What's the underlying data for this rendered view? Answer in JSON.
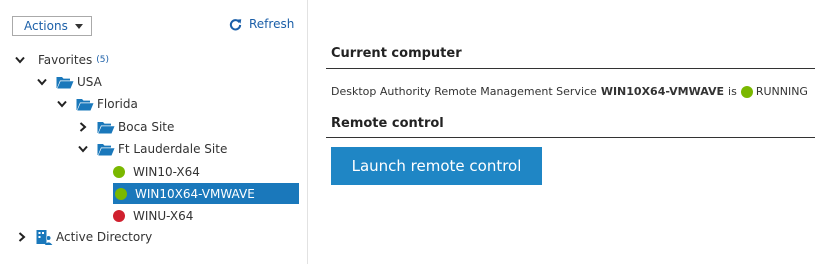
{
  "toolbar": {
    "actions_label": "Actions",
    "refresh_label": "Refresh"
  },
  "colors": {
    "accent": "#1a78bb",
    "online": "#7ab800",
    "offline": "#d0202e",
    "folder": "#1a78bb"
  },
  "tree": {
    "favorites": {
      "label": "Favorites",
      "count": "(5)"
    },
    "usa": {
      "label": "USA"
    },
    "florida": {
      "label": "Florida"
    },
    "boca": {
      "label": "Boca Site"
    },
    "ftl": {
      "label": "Ft Lauderdale Site"
    },
    "computers": [
      {
        "label": "WIN10-X64",
        "status": "online"
      },
      {
        "label": "WIN10X64-VMWAVE",
        "status": "online",
        "selected": true
      },
      {
        "label": "WINU-X64",
        "status": "offline"
      }
    ],
    "ad": {
      "label": "Active Directory"
    }
  },
  "main": {
    "current_title": "Current computer",
    "status_prefix": "Desktop Authority Remote Management Service",
    "computer_name": "WIN10X64-VMWAVE",
    "status_is": "is",
    "status_text": "RUNNING",
    "remote_title": "Remote control",
    "launch_label": "Launch remote control"
  }
}
